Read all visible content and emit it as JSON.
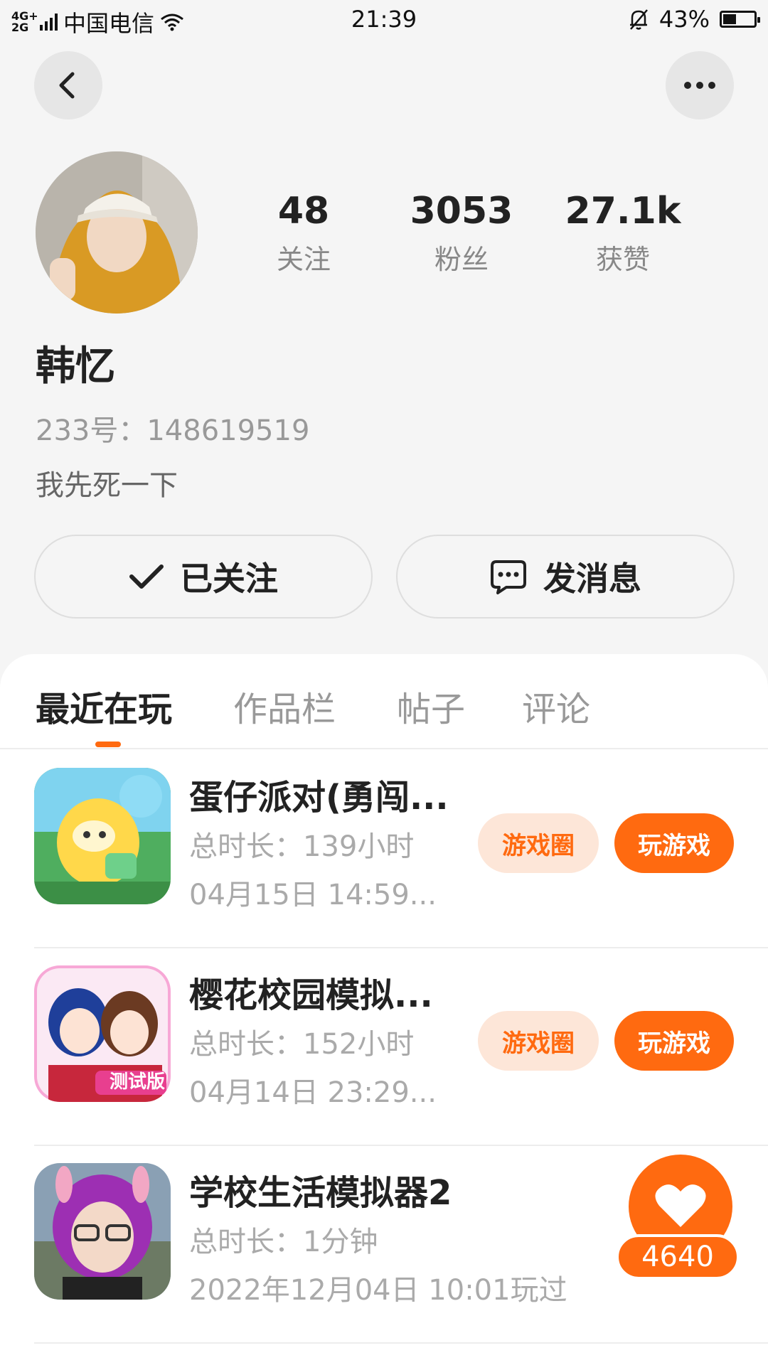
{
  "status_bar": {
    "network": "4G+ 2G",
    "carrier": "中国电信",
    "time": "21:39",
    "battery": "43%",
    "battery_level": 0.43,
    "icons": [
      "signal-icon",
      "wifi-icon",
      "mute-bell-icon",
      "battery-icon"
    ]
  },
  "header": {
    "back_icon": "chevron-left-icon",
    "more_icon": "more-dots-icon"
  },
  "profile": {
    "name": "韩忆",
    "id_text": "233号：148619519",
    "bio": "我先死一下",
    "stats": [
      {
        "value": "48",
        "label": "关注"
      },
      {
        "value": "3053",
        "label": "粉丝"
      },
      {
        "value": "27.1k",
        "label": "获赞"
      }
    ],
    "follow_button": "已关注",
    "message_button": "发消息"
  },
  "tabs": [
    {
      "label": "最近在玩",
      "active": true
    },
    {
      "label": "作品栏",
      "active": false
    },
    {
      "label": "帖子",
      "active": false
    },
    {
      "label": "评论",
      "active": false
    }
  ],
  "games": [
    {
      "title": "蛋仔派对(勇闯...",
      "duration": "总时长：139小时",
      "last_played": "04月15日 14:59...",
      "circle_label": "游戏圈",
      "play_label": "玩游戏"
    },
    {
      "title": "樱花校园模拟...",
      "duration": "总时长：152小时",
      "last_played": "04月14日 23:29...",
      "circle_label": "游戏圈",
      "play_label": "玩游戏",
      "icon_badge": "测试版"
    },
    {
      "title": "学校生活模拟器2",
      "duration": "总时长：1分钟",
      "last_played": "2022年12月04日 10:01玩过"
    }
  ],
  "like_fab": {
    "count": "4640",
    "icon": "heart-icon"
  },
  "colors": {
    "accent": "#ff6a10",
    "accent_light": "#fde6d8",
    "background": "#f5f5f5"
  }
}
